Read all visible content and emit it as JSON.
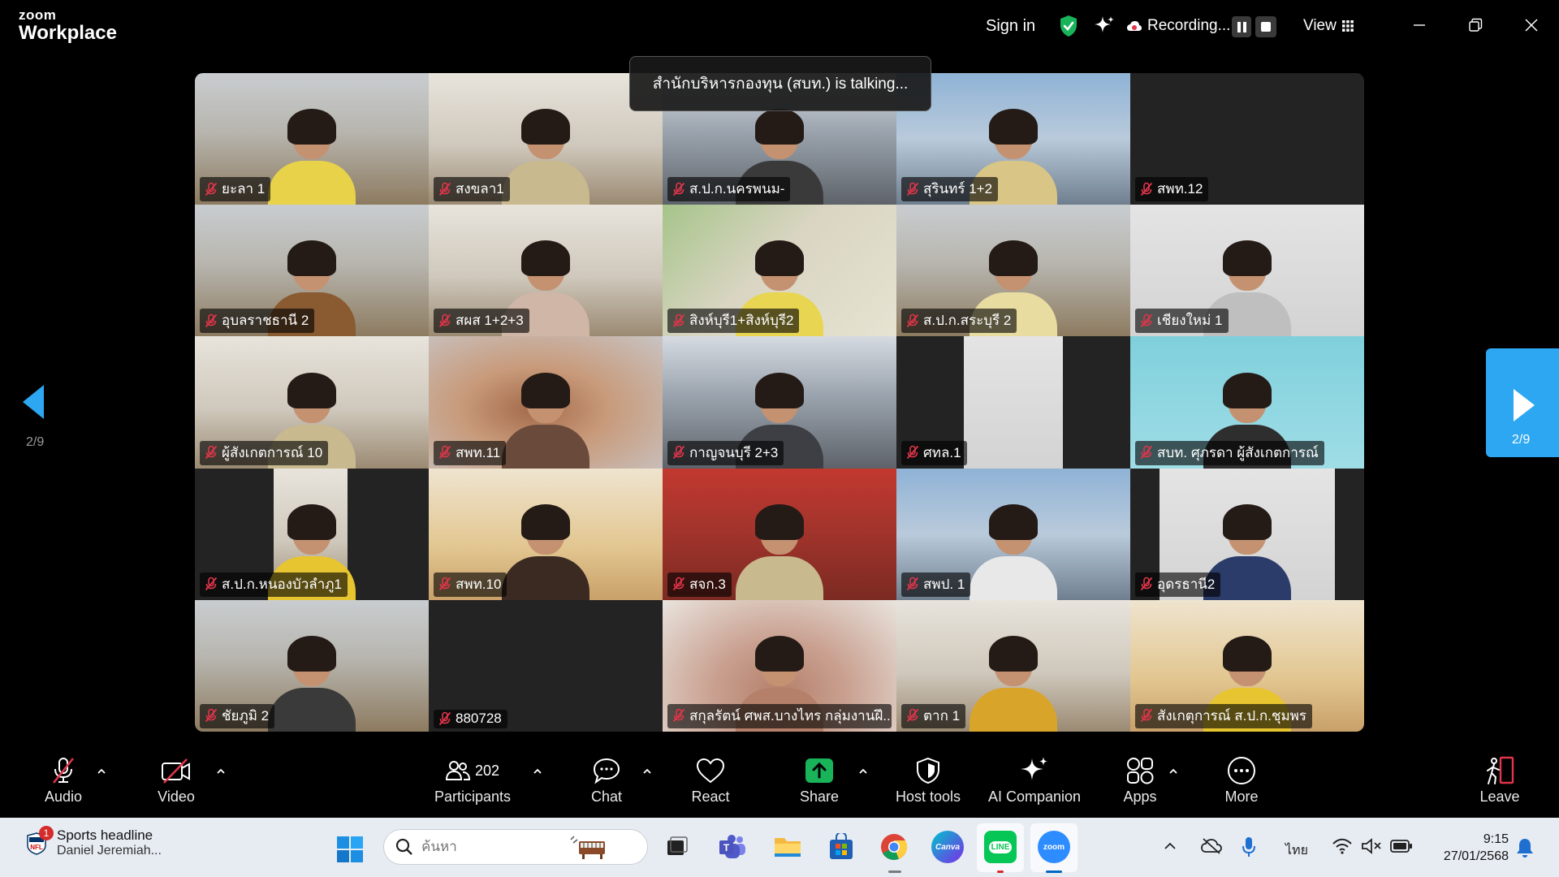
{
  "app": {
    "brand_top": "zoom",
    "brand_name": "Workplace"
  },
  "titlebar": {
    "sign_in": "Sign in",
    "recording": "Recording...",
    "view": "View",
    "accent_green": "#19b35a"
  },
  "talking_banner": "สำนักบริหารกองทุน (สบท.) is talking...",
  "tiles": [
    {
      "label": "ยะลา 1",
      "bg": "office"
    },
    {
      "label": "สงขลา1",
      "bg": "room"
    },
    {
      "label": "ส.ป.ก.นครพนม-",
      "bg": "class"
    },
    {
      "label": "สุรินทร์ 1+2",
      "bg": "blue"
    },
    {
      "label": "สพท.12",
      "bg": "dark"
    },
    {
      "label": "อุบลราชธานี 2",
      "bg": "office"
    },
    {
      "label": "สผส 1+2+3",
      "bg": "room"
    },
    {
      "label": "สิงห์บุรี1+สิงห์บุรี2",
      "bg": "map"
    },
    {
      "label": "ส.ป.ก.สระบุรี 2",
      "bg": "office"
    },
    {
      "label": "เชียงใหม่ 1",
      "bg": "grey"
    },
    {
      "label": "ผู้สังเกตการณ์ 10",
      "bg": "room"
    },
    {
      "label": "สพท.11",
      "bg": "hair"
    },
    {
      "label": "กาญจนบุรี 2+3",
      "bg": "class"
    },
    {
      "label": "ศทล.1",
      "bg": "dark"
    },
    {
      "label": "สบท. ศุภรดา ผู้สังเกตการณ์",
      "bg": "teal"
    },
    {
      "label": "ส.ป.ก.หนองบัวลำภู1",
      "bg": "dark"
    },
    {
      "label": "สพท.10",
      "bg": "warm"
    },
    {
      "label": "สจก.3",
      "bg": "red"
    },
    {
      "label": "สพป. 1",
      "bg": "blue"
    },
    {
      "label": "อุดรธานี2",
      "bg": "dark"
    },
    {
      "label": "ชัยภูมิ 2",
      "bg": "office"
    },
    {
      "label": "880728",
      "bg": "dark"
    },
    {
      "label": "สกุลรัตน์ ศพส.บางไทร กลุ่มงานฝึ...",
      "bg": "face"
    },
    {
      "label": "ตาก 1",
      "bg": "room"
    },
    {
      "label": "สังเกตุการณ์ ส.ป.ก.ชุมพร",
      "bg": "warm"
    }
  ],
  "pagination": {
    "left": "2/9",
    "right": "2/9",
    "accent": "#2da7f1"
  },
  "toolbar": {
    "audio": "Audio",
    "video": "Video",
    "participants": "Participants",
    "participants_count": "202",
    "chat": "Chat",
    "react": "React",
    "share": "Share",
    "host_tools": "Host tools",
    "ai_companion": "AI Companion",
    "apps": "Apps",
    "more": "More",
    "leave": "Leave",
    "share_color": "#19b35a",
    "muted_color": "#e0354a"
  },
  "taskbar": {
    "news_title": "Sports headline",
    "news_sub": "Daniel Jeremiah...",
    "news_badge": "1",
    "search_placeholder": "ค้นหา",
    "lang": "ไทย",
    "time": "9:15",
    "date": "27/01/2568",
    "canva_label": "Canva",
    "line_label": "LINE",
    "zoom_label": "zoom"
  }
}
